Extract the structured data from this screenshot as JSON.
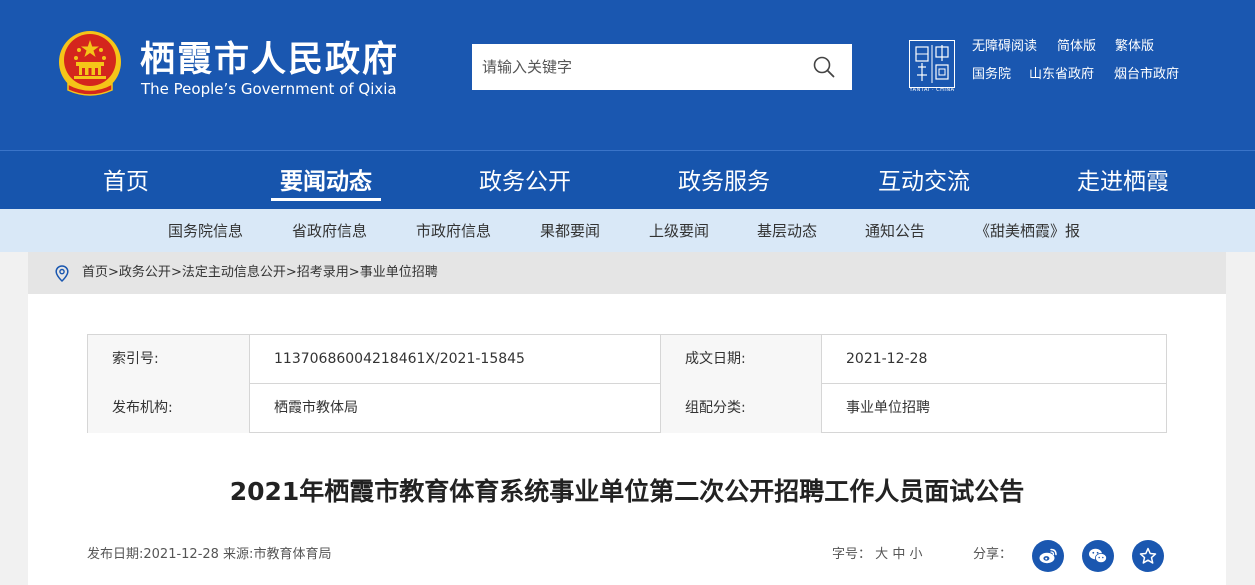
{
  "header": {
    "title": "栖霞市人民政府",
    "subtitle": "The People’s Government of Qixia",
    "search": {
      "placeholder": "请输入关键字"
    },
    "seal_caption": "YANTAI · CHINA",
    "links": {
      "accessible": "无障碍阅读",
      "simplified": "简体版",
      "traditional": "繁体版",
      "state_council": "国务院",
      "shandong": "山东省政府",
      "yantai": "烟台市政府"
    }
  },
  "main_nav": [
    {
      "label": "首页"
    },
    {
      "label": "要闻动态",
      "active": true
    },
    {
      "label": "政务公开"
    },
    {
      "label": "政务服务"
    },
    {
      "label": "互动交流"
    },
    {
      "label": "走进栖霞"
    }
  ],
  "sub_nav": [
    {
      "label": "国务院信息"
    },
    {
      "label": "省政府信息"
    },
    {
      "label": "市政府信息"
    },
    {
      "label": "果都要闻"
    },
    {
      "label": "上级要闻"
    },
    {
      "label": "基层动态"
    },
    {
      "label": "通知公告"
    },
    {
      "label": "《甜美栖霞》报"
    }
  ],
  "breadcrumb": {
    "items": [
      "首页",
      "政务公开",
      "法定主动信息公开",
      "招考录用",
      "事业单位招聘"
    ],
    "separator": ">"
  },
  "info": {
    "index_label": "索引号:",
    "index_value": "11370686004218461X/2021-15845",
    "date_label": "成文日期:",
    "date_value": "2021-12-28",
    "org_label": "发布机构:",
    "org_value": "栖霞市教体局",
    "category_label": "组配分类:",
    "category_value": "事业单位招聘"
  },
  "article": {
    "title": "2021年栖霞市教育体育系统事业单位第二次公开招聘工作人员面试公告",
    "meta": "发布日期:2021-12-28 来源:市教育体育局",
    "font_size_label": "字号：",
    "font_large": "大",
    "font_medium": "中",
    "font_small": "小",
    "share_label": "分享："
  },
  "colors": {
    "header_bg": "#1a57b0",
    "subnav_bg": "#d9e8f7",
    "emblem_red": "#d4261d",
    "emblem_gold": "#f5c518"
  }
}
